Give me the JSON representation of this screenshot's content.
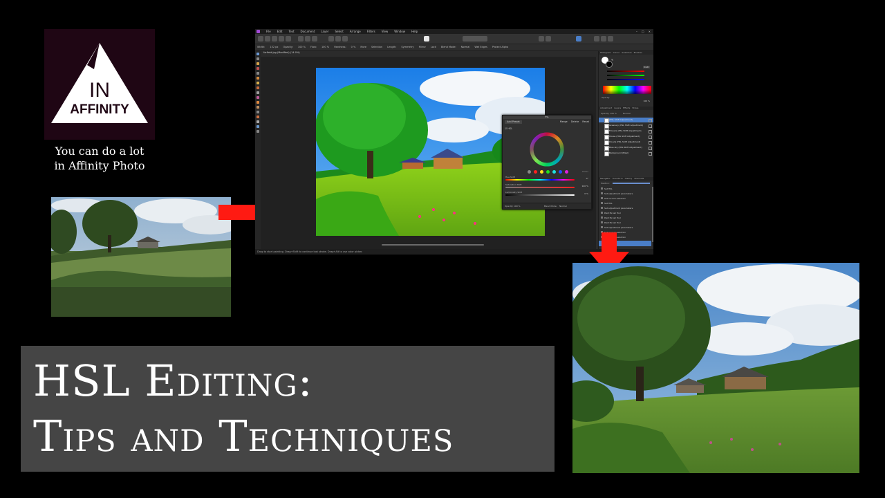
{
  "logo": {
    "line1": "IN",
    "line2": "AFFINITY"
  },
  "tagline": {
    "line1": "You can do a lot",
    "line2": "in Affinity Photo"
  },
  "title": {
    "line1": "HSL Editing:",
    "line2": "Tips and Techniques"
  },
  "colors": {
    "arrow": "#ff1a12",
    "title_bg": "#454545",
    "logo_bg": "#1f0614",
    "app_accent": "#a24bd6",
    "selection": "#4a7ec8"
  },
  "app": {
    "menu": [
      "File",
      "Edit",
      "Text",
      "Document",
      "Layer",
      "Select",
      "Arrange",
      "Filters",
      "View",
      "Window",
      "Help"
    ],
    "window_controls": [
      "–",
      "□",
      "×"
    ],
    "context_bar": [
      "Width:",
      "152 px",
      "Opacity:",
      "100 %",
      "Flow:",
      "100 %",
      "Hardness:",
      "0 %",
      "More",
      "Selection",
      "Length:",
      "Symmetry",
      "Mirror",
      "Lock",
      "Blend Mode:",
      "Normal",
      "Wet Edges",
      "Protect Alpha"
    ],
    "document_tab": "farfield.jpg (Modified) (14.0%)",
    "status_text": "Drag to start painting. Drag+Shift to continue last stroke. Drag+Alt to use color picker.",
    "hsl_dialog": {
      "title": "HSL",
      "preset": "Add Preset",
      "buttons": [
        "Merge",
        "Delete",
        "Reset"
      ],
      "checkbox": "HSL",
      "picker": "Picker",
      "sliders": [
        {
          "label": "Hue Shift",
          "value": "0°",
          "fill": 0.5
        },
        {
          "label": "Saturation Shift",
          "value": "100 %",
          "fill": 1.0
        },
        {
          "label": "Luminosity Shift",
          "value": "0 %",
          "fill": 0.5
        }
      ],
      "opacity_label": "Opacity:",
      "opacity_value": "100 %",
      "blend_label": "Blend Mode:",
      "blend_value": "Normal"
    },
    "panels": {
      "color_tabs": [
        "Histogram",
        "Colour",
        "Swatches",
        "Brushes"
      ],
      "color_mode": "RGB",
      "opacity_label": "Opacity",
      "opacity_value": "100 %",
      "layers_tabs": [
        "Adjustment",
        "Layers",
        "Effects",
        "Styles"
      ],
      "layers_opacity_label": "Opacity:",
      "layers_opacity_value": "100 %",
      "layers_blend_value": "Normal",
      "layers": [
        {
          "name": "(HSL Shift Adjustment)",
          "selected": true
        },
        {
          "name": "Greenery (HSL Shift Adjustment)",
          "selected": false
        },
        {
          "name": "Flowers (HSL Shift Adjustment)",
          "selected": false
        },
        {
          "name": "House (HSL Shift Adjustment)",
          "selected": false
        },
        {
          "name": "Clouds (HSL Shift Adjustment)",
          "selected": false
        },
        {
          "name": "Blue sky (HSL Shift Adjustment)",
          "selected": false
        },
        {
          "name": "Background (Pixel)",
          "selected": false
        }
      ],
      "history_tabs": [
        "Navigator",
        "Transform",
        "History",
        "Channels"
      ],
      "history_position_label": "Position:",
      "history": [
        "Set HSL",
        "Set adjustment parameters",
        "Set current selection",
        "Set HSL",
        "Set adjustment parameters",
        "Paint Brush Tool",
        "Paint Brush Tool",
        "Paint Brush Tool",
        "Set adjustment parameters",
        "Set current selection",
        "Set current selection"
      ]
    }
  }
}
